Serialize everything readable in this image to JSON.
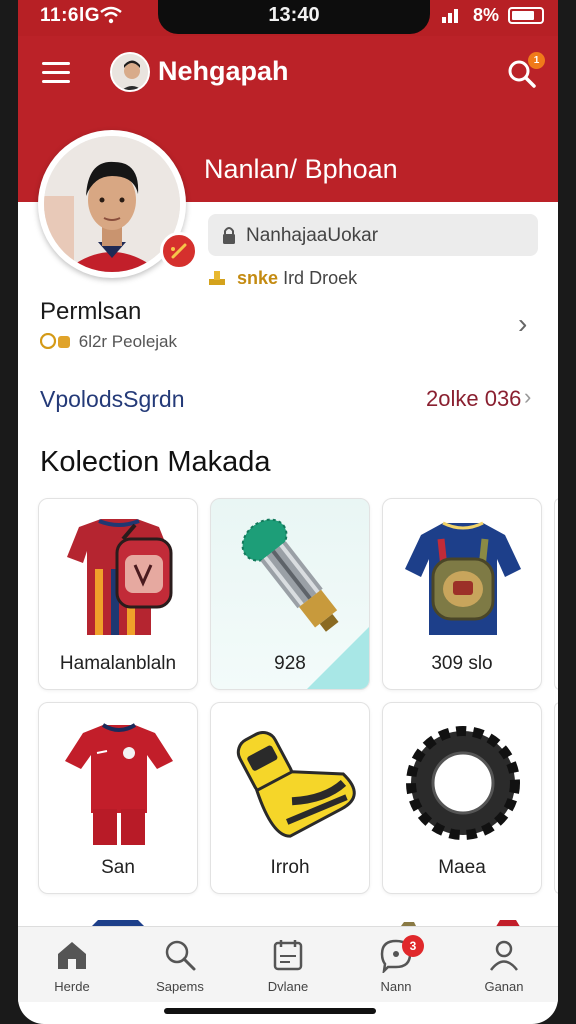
{
  "status_bar": {
    "time_left": "11:6lG",
    "clock": "13:40",
    "battery": "8%"
  },
  "header": {
    "title": "Nehgapah",
    "search_badge": "1"
  },
  "profile": {
    "name": "Nanlan/ Bphoan",
    "field_text": "NanhajaaUokar",
    "stat_strong": "snke",
    "stat_text": "Ird Droek"
  },
  "preference": {
    "title": "Permlsan",
    "subtitle": "6l2r Peolejak"
  },
  "link_row": {
    "left": "VpolodsSgrdn",
    "right": "2olke 036"
  },
  "section": {
    "title": "Kolection Makada"
  },
  "collection": [
    {
      "label": "Hamalanblaln",
      "icon": "jersey-backpack-icon"
    },
    {
      "label": "928",
      "icon": "microphone-icon"
    },
    {
      "label": "309 slo",
      "icon": "shirt-backpack-icon"
    },
    {
      "label": "San",
      "icon": "red-kit-icon"
    },
    {
      "label": "Irroh",
      "icon": "yellow-cleat-icon"
    },
    {
      "label": "Maea",
      "icon": "tire-ring-icon"
    }
  ],
  "bottom_nav": [
    {
      "label": "Herde",
      "icon": "home-icon"
    },
    {
      "label": "Sapems",
      "icon": "search-icon"
    },
    {
      "label": "Dvlane",
      "icon": "calendar-icon"
    },
    {
      "label": "Nann",
      "icon": "chat-icon",
      "badge": "3"
    },
    {
      "label": "Ganan",
      "icon": "profile-icon"
    }
  ],
  "colors": {
    "brand_red": "#bb2228",
    "accent_teal": "#a8e7e6",
    "stat_gold": "#c48b12",
    "link_blue": "#243a78"
  }
}
